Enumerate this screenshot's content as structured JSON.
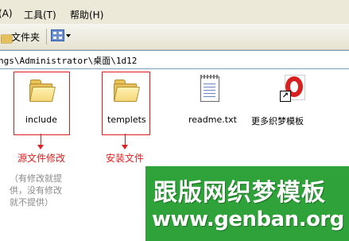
{
  "menubar": {
    "items": [
      {
        "label": "(A)",
        "key": "A"
      },
      {
        "label": "工具(T)"
      },
      {
        "label": "帮助(H)"
      }
    ]
  },
  "toolbar": {
    "folders_label": "文件夹"
  },
  "address": {
    "path": "ngs\\Administrator\\桌面\\1d12"
  },
  "files": [
    {
      "name": "include",
      "kind": "folder"
    },
    {
      "name": "templets",
      "kind": "folder"
    },
    {
      "name": "readme.txt",
      "kind": "text-file"
    },
    {
      "name": "更多织梦模板",
      "kind": "shortcut"
    }
  ],
  "annotations": {
    "source_label": "源文件修改",
    "install_label": "安装文件",
    "note_lines": [
      "（有修改就提",
      "供，没有修改",
      "就不提供）"
    ]
  },
  "watermark": {
    "title": "跟版网织梦模板",
    "url": "www.genban.org",
    "bg_color": "#2fa33a"
  },
  "colors": {
    "annotation_red": "#e02020"
  }
}
